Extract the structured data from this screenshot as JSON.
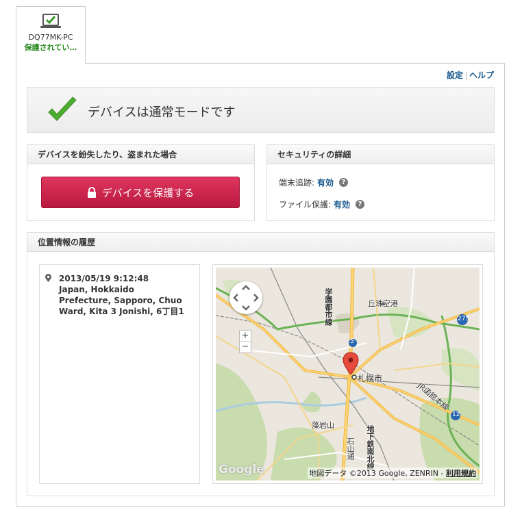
{
  "device_tab": {
    "name": "DQ77MK-PC",
    "status": "保護されてい…"
  },
  "toplinks": {
    "settings": "設定",
    "help": "ヘルプ"
  },
  "banner": {
    "message": "デバイスは通常モードです"
  },
  "lost_panel": {
    "title": "デバイスを紛失したり、盗まれた場合",
    "button_label": "デバイスを保護する"
  },
  "security_panel": {
    "title": "セキュリティの詳細",
    "tracking_label": "端末追跡:",
    "tracking_value": "有効",
    "file_label": "ファイル保護:",
    "file_value": "有効"
  },
  "location_panel": {
    "title": "位置情報の履歴",
    "entries": [
      {
        "timestamp": "2013/05/19 9:12:48",
        "address": "Japan, Hokkaido Prefecture, Sapporo, Chuo Ward, Kita 3 Jonishi, 6丁目1"
      }
    ]
  },
  "map": {
    "labels": {
      "city": "札幌市",
      "airport": "丘珠空港",
      "mountain": "藻岩山",
      "rail1": "学園都市線",
      "rail2": "地下鉄南北線",
      "road_jr": "JR函館本線",
      "road_ishiyama": "石山通",
      "route5": "5",
      "route275": "275",
      "route12": "12"
    },
    "logo": "Google",
    "attribution": "地図データ ©2013 Google, ZENRIN - ",
    "terms": "利用規約",
    "zoom_in": "+",
    "zoom_out": "−"
  },
  "colors": {
    "accent_link": "#1a5a8e",
    "status_green": "#2a8a1f",
    "button_red": "#d02650"
  }
}
